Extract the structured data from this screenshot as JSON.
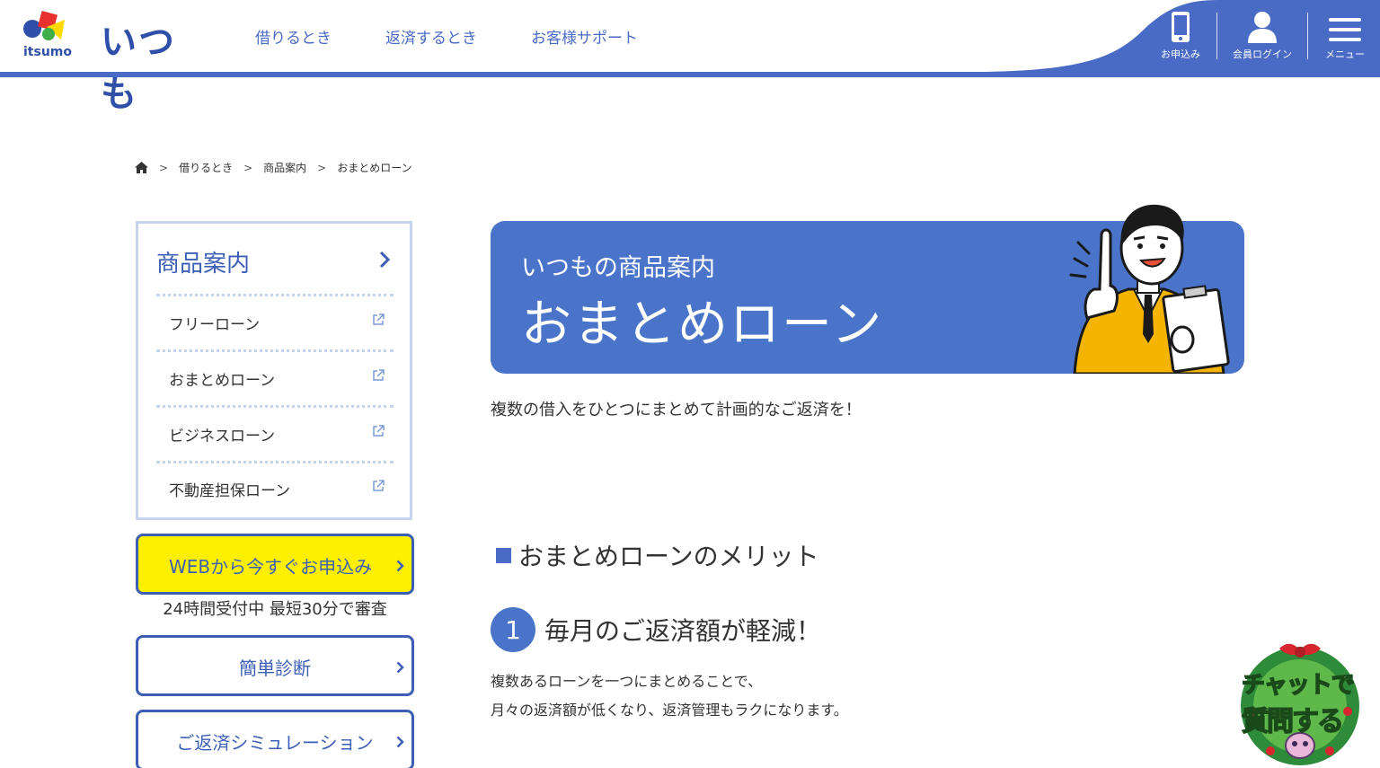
{
  "header": {
    "logo_text": "いつも",
    "logo_sub": "itsumo",
    "nav": [
      "借りるとき",
      "返済するとき",
      "お客様サポート"
    ],
    "buttons": {
      "apply": "お申込み",
      "login": "会員ログイン",
      "menu": "メニュー"
    },
    "icons": [
      "smartphone-icon",
      "person-icon",
      "hamburger-icon"
    ],
    "accent_color": "#4a6bc5"
  },
  "breadcrumb": {
    "items": [
      "借りるとき",
      "商品案内",
      "おまとめローン"
    ],
    "separator": ">"
  },
  "sidebar": {
    "title": "商品案内",
    "items": [
      "フリーローン",
      "おまとめローン",
      "ビジネスローン",
      "不動産担保ローン"
    ],
    "web_apply": "WEBから今すぐお申込み",
    "web_note": "24時間受付中 最短30分で審査",
    "diagnosis": "簡単診断",
    "simulation": "ご返済シミュレーション"
  },
  "hero": {
    "subtitle": "いつもの商品案内",
    "title": "おまとめローン",
    "color": "#4a74c9"
  },
  "main": {
    "lead": "複数の借入をひとつにまとめて計画的なご返済を！",
    "merit_heading": "おまとめローンのメリット",
    "point_number": "1",
    "point_title": "毎月のご返済額が軽減！",
    "body_lines": [
      "複数あるローンを一つにまとめることで、",
      "月々の返済額が低くなり、返済管理もラクになります。"
    ]
  },
  "chat": {
    "line1": "チャットで",
    "line2": "質問する"
  }
}
